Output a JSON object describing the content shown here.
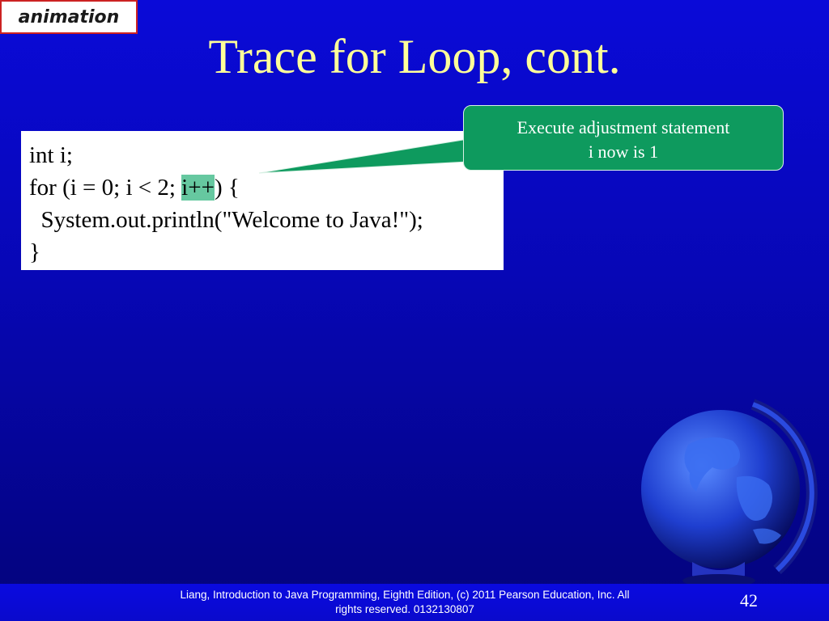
{
  "badge": {
    "label": "animation"
  },
  "slide": {
    "title": "Trace for Loop, cont."
  },
  "code": {
    "line1": "int i;",
    "line2_pre": "for (i = 0; i < 2; ",
    "line2_hl": "i++",
    "line2_post": ") {",
    "line3": "  System.out.println(\"Welcome to Java!\");",
    "line4": "}"
  },
  "callout": {
    "line1": "Execute adjustment statement",
    "line2": "i now is 1"
  },
  "footer": {
    "line1": "Liang, Introduction to Java Programming, Eighth Edition, (c) 2011 Pearson Education, Inc. All",
    "line2": "rights reserved. 0132130807",
    "page": "42"
  },
  "colors": {
    "title": "#ffff99",
    "callout": "#0e9a5e",
    "highlight": "#66c8a0",
    "badge_border": "#cc2222"
  },
  "icons": [
    "globe-icon"
  ]
}
